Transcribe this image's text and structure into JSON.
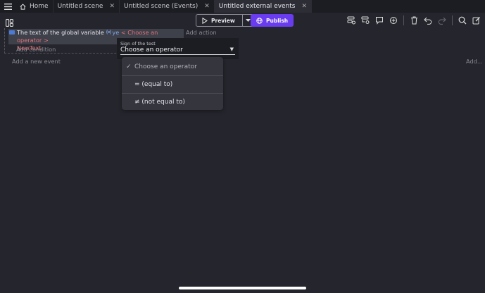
{
  "tabs": [
    {
      "label": "Home",
      "icon": "home-icon"
    },
    {
      "label": "Untitled scene"
    },
    {
      "label": "Untitled scene (Events)"
    },
    {
      "label": "Untitled external events",
      "active": true
    }
  ],
  "toolbar": {
    "preview_label": "Preview",
    "publish_label": "Publish",
    "accent_color": "#6a3cf0"
  },
  "event": {
    "condition_text": "The text of the global variable",
    "variable_name": "ye",
    "operator_placeholder": "< Choose an operator >",
    "value_text": "NewText.",
    "add_condition": "Add condition",
    "add_action": "Add action"
  },
  "add_event": "Add a new event",
  "add_more": "Add...",
  "operator_field": {
    "label": "Sign of the test",
    "value": "Choose an operator"
  },
  "dropdown": {
    "options": [
      {
        "label": "Choose an operator",
        "selected": true,
        "check": "✓"
      },
      {
        "label": "= (equal to)"
      },
      {
        "label": "≠ (not equal to)"
      }
    ]
  }
}
